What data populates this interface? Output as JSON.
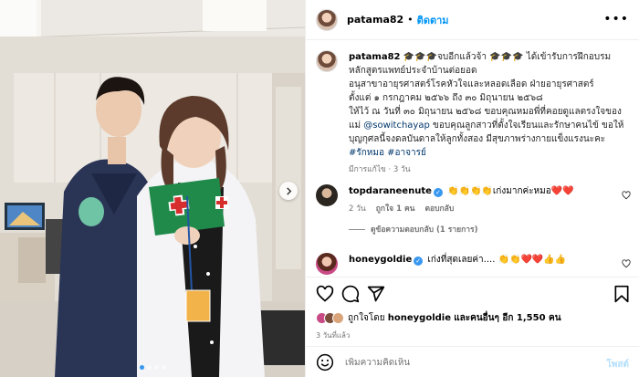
{
  "header": {
    "username": "patama82",
    "separator": "•",
    "follow_label": "ติดตาม",
    "more_icon": "more-horizontal-icon"
  },
  "caption": {
    "username": "patama82",
    "text": "🎓🎓🎓จบอีกแล้วจ้า 🎓🎓🎓 ได้เข้ารับการฝึกอบรมหลักสูตรแพทย์ประจำบ้านต่อยอด\nอนุสาขาอายุรศาสตร์โรคหัวใจและหลอดเลือด ฝ่ายอายุรศาสตร์\nตั้งแต่ ๑ กรกฎาคม ๒๕๖๖ ถึง ๓๐ มิถุนายน ๒๕๖๘\nให้ไว้ ณ วันที่ ๓๐ มิถุนายน ๒๕๖๘ ขอบคุณหมอพี่ที่คอยดูแลตรงใจของแม่",
    "mention": "@sowitchayap",
    "text_after": " ขอบคุณลูกสาวที่ตั้งใจเรียนและรักษาคนไข้ ขอให้บุญกุศลนี้จงดลบันดาลให้ลูกทั้งสอง มีสุขภาพร่างกายแข็งแรงนะคะ",
    "hashtags": "#รักหมอ #อาจารย์",
    "meta": "มีการแก้ไข · 3 วัน"
  },
  "comments": [
    {
      "username": "topdaraneenute",
      "verified": true,
      "text": "👏👏👏👏เก่งมากค่ะหมอ❤️❤️",
      "time": "2 วัน",
      "likes": "ถูกใจ 1 คน",
      "reply_label": "ตอบกลับ",
      "view_replies": "ดูข้อความตอบกลับ (1 รายการ)",
      "avatar_color": "#2b2620"
    },
    {
      "username": "honeygoldie",
      "verified": true,
      "text": "เก่งที่สุดเลยค่า.... 👏👏❤️❤️👍👍",
      "avatar_color": "#c94b86"
    }
  ],
  "actions": {
    "like_icon": "heart-icon",
    "comment_icon": "comment-icon",
    "share_icon": "share-icon",
    "save_icon": "bookmark-icon",
    "liked_by_prefix": "ถูกใจโดย",
    "liked_by_user": "honeygoldie",
    "liked_by_suffix": "และคนอื่นๆ อีก 1,550 คน",
    "time_ago": "3 วันที่แล้ว"
  },
  "composer": {
    "emoji_icon": "emoji-icon",
    "placeholder": "เพิ่มความคิดเห็น",
    "post_label": "โพสต์"
  },
  "photo": {
    "description_icon": "post-photo",
    "carousel_next_icon": "chevron-right-icon",
    "slides_count": 4,
    "active_slide": 1
  },
  "colors": {
    "accent": "#0095f6",
    "link": "#00376b",
    "muted": "#737373",
    "verified": "#3897f0"
  }
}
